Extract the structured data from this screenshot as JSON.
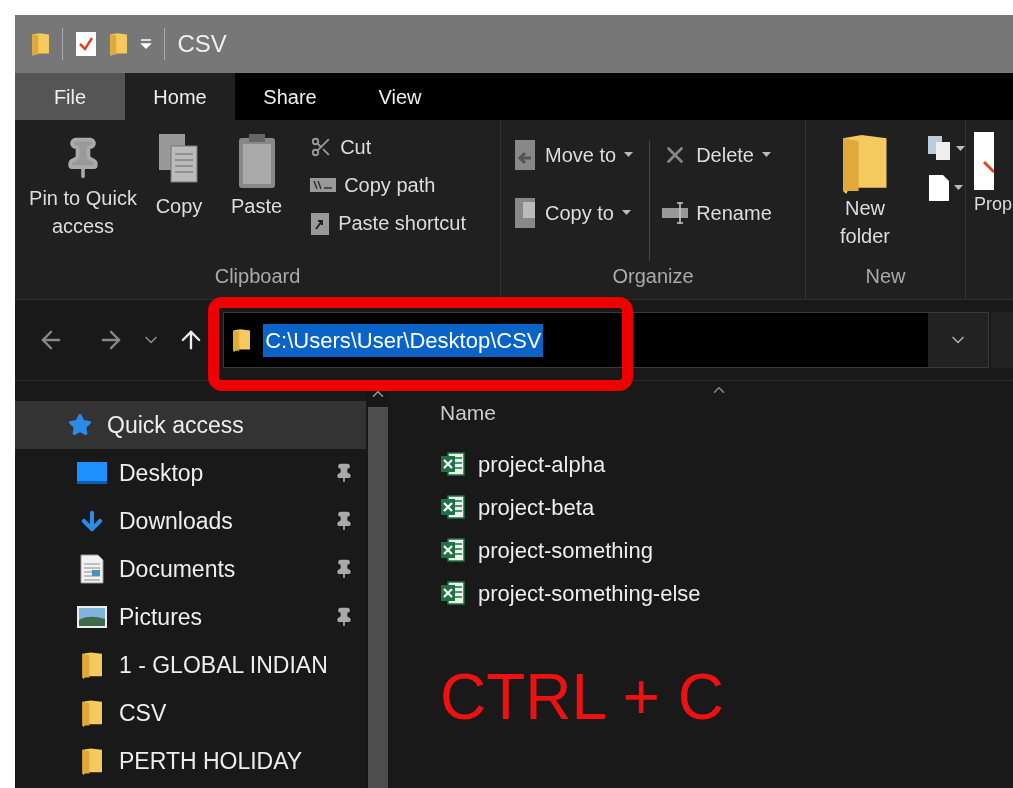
{
  "window": {
    "title": "CSV"
  },
  "ribbon_tabs": [
    {
      "label": "File",
      "kind": "file",
      "selected": false
    },
    {
      "label": "Home",
      "kind": "tab",
      "selected": true
    },
    {
      "label": "Share",
      "kind": "tab",
      "selected": false
    },
    {
      "label": "View",
      "kind": "tab",
      "selected": false
    }
  ],
  "clipboard": {
    "label": "Clipboard",
    "pin": "Pin to Quick access",
    "copy": "Copy",
    "paste": "Paste",
    "cut": "Cut",
    "copy_path": "Copy path",
    "paste_shortcut": "Paste shortcut"
  },
  "organize": {
    "label": "Organize",
    "move_to": "Move to",
    "copy_to": "Copy to",
    "delete": "Delete",
    "rename": "Rename"
  },
  "new": {
    "label": "New",
    "new_folder": "New folder"
  },
  "open": {
    "properties": "Prop"
  },
  "address": {
    "path": "C:\\Users\\User\\Desktop\\CSV",
    "selected": true
  },
  "sidebar": {
    "items": [
      {
        "label": "Quick access",
        "kind": "star",
        "selected": true,
        "pinned": false
      },
      {
        "label": "Desktop",
        "kind": "desktop",
        "selected": false,
        "pinned": true
      },
      {
        "label": "Downloads",
        "kind": "downloads",
        "selected": false,
        "pinned": true
      },
      {
        "label": "Documents",
        "kind": "documents",
        "selected": false,
        "pinned": true
      },
      {
        "label": "Pictures",
        "kind": "pictures",
        "selected": false,
        "pinned": true
      },
      {
        "label": "1 - GLOBAL INDIAN",
        "kind": "folder",
        "selected": false,
        "pinned": false
      },
      {
        "label": "CSV",
        "kind": "folder",
        "selected": false,
        "pinned": false
      },
      {
        "label": "PERTH HOLIDAY",
        "kind": "folder",
        "selected": false,
        "pinned": false
      }
    ]
  },
  "file_list": {
    "column": "Name",
    "files": [
      {
        "name": "project-alpha"
      },
      {
        "name": "project-beta"
      },
      {
        "name": "project-something"
      },
      {
        "name": "project-something-else"
      }
    ]
  },
  "annotation": {
    "frame_around_address": true,
    "caption": "CTRL + C"
  }
}
